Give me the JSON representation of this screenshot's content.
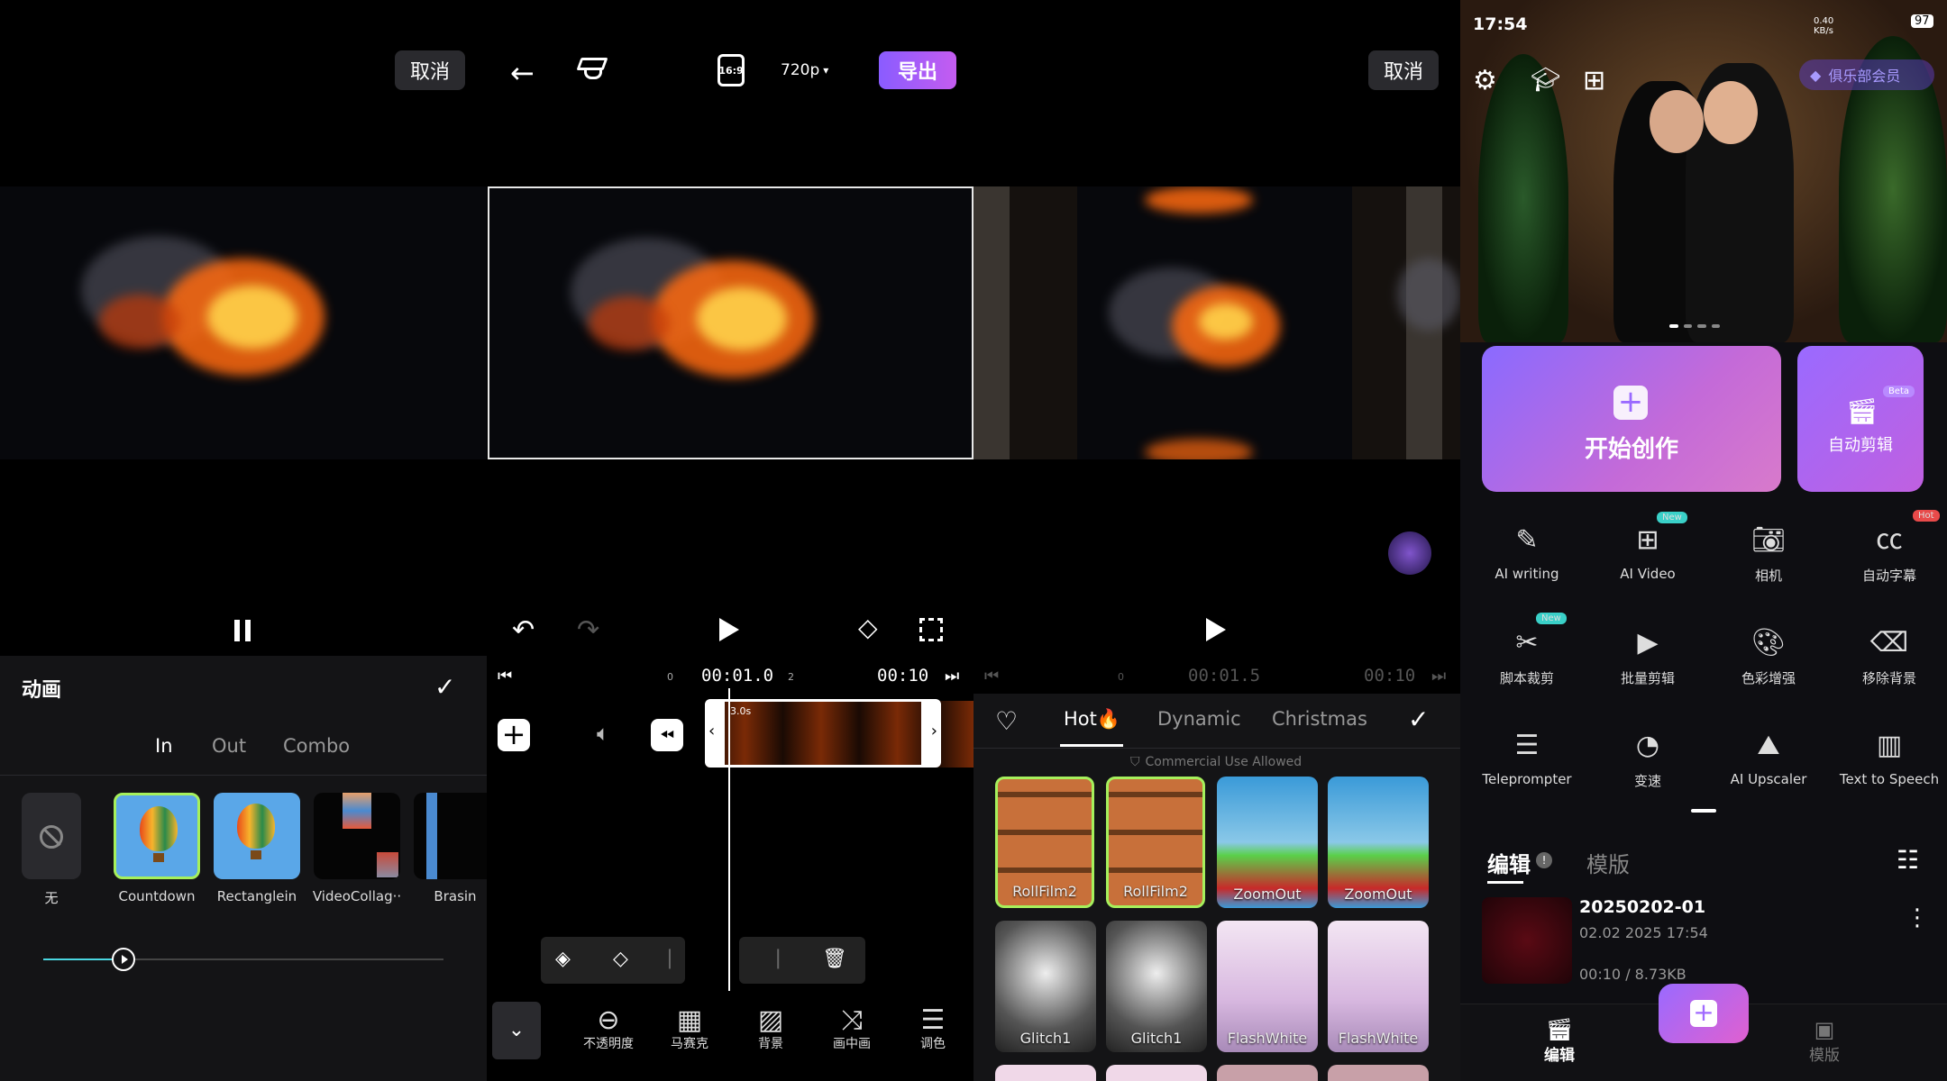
{
  "panel1": {
    "cancel_label": "取消",
    "section_title": "动画",
    "tabs": [
      {
        "label": "In"
      },
      {
        "label": "Out"
      },
      {
        "label": "Combo"
      }
    ],
    "presets": [
      {
        "label": "无"
      },
      {
        "label": "Countdown"
      },
      {
        "label": "Rectanglein"
      },
      {
        "label": "VideoCollag··"
      },
      {
        "label": "Brasin"
      }
    ],
    "slider_value": 0.2
  },
  "panel2": {
    "ratio_label": "16:9",
    "resolution_label": "720p",
    "export_label": "导出",
    "current_time": "00:01.0",
    "total_time": "00:10",
    "tick_0": "0",
    "tick_2": "2",
    "clip_duration": "3.0s",
    "tools": [
      {
        "label": "不透明度"
      },
      {
        "label": "马赛克"
      },
      {
        "label": "背景"
      },
      {
        "label": "画中画"
      },
      {
        "label": "调色"
      }
    ]
  },
  "panel3": {
    "cancel_label": "取消",
    "current_time": "00:01.5",
    "total_time": "00:10",
    "tick_0": "0",
    "tabs": [
      {
        "label": "Hot🔥"
      },
      {
        "label": "Dynamic"
      },
      {
        "label": "Christmas"
      }
    ],
    "commercial_label": "Commercial Use Allowed",
    "effects": [
      {
        "label": "RollFilm2"
      },
      {
        "label": "RollFilm2"
      },
      {
        "label": "ZoomOut"
      },
      {
        "label": "ZoomOut"
      },
      {
        "label": "Glitch1"
      },
      {
        "label": "Glitch1"
      },
      {
        "label": "FlashWhite"
      },
      {
        "label": "FlashWhite"
      }
    ]
  },
  "panel4": {
    "status_time": "17:54",
    "network": "0.40 KB/s",
    "battery": "97",
    "club_label": "俱乐部会员",
    "start_label": "开始创作",
    "auto_edit_label": "自动剪辑",
    "beta_badge": "Beta",
    "tools": [
      {
        "label": "AI writing",
        "badge": ""
      },
      {
        "label": "AI Video",
        "badge": "New"
      },
      {
        "label": "相机",
        "badge": ""
      },
      {
        "label": "自动字幕",
        "badge": "Hot"
      },
      {
        "label": "脚本裁剪",
        "badge": "New"
      },
      {
        "label": "批量剪辑",
        "badge": ""
      },
      {
        "label": "色彩增强",
        "badge": ""
      },
      {
        "label": "移除背景",
        "badge": ""
      },
      {
        "label": "Teleprompter",
        "badge": ""
      },
      {
        "label": "变速",
        "badge": ""
      },
      {
        "label": "AI Upscaler",
        "badge": ""
      },
      {
        "label": "Text to Speech",
        "badge": ""
      }
    ],
    "tab_edit": "编辑",
    "tab_template": "模版",
    "project": {
      "name": "20250202-01",
      "date": "02.02 2025 17:54",
      "meta": "00:10 / 8.73KB"
    },
    "nav_edit": "编辑",
    "nav_template": "模版"
  }
}
